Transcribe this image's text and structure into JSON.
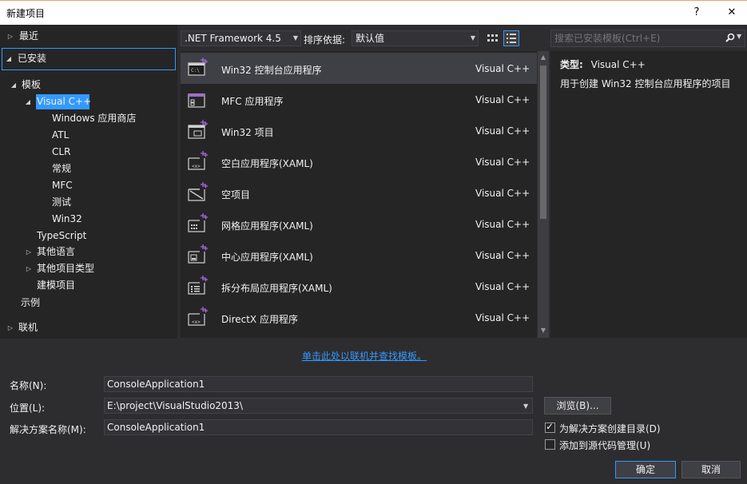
{
  "window": {
    "title": "新建项目",
    "help": "?",
    "close": "✕"
  },
  "tree": {
    "recent": "最近",
    "installed": "已安装",
    "templates": "模板",
    "visual_cpp": "Visual C++",
    "vc_children": [
      "Windows 应用商店",
      "ATL",
      "CLR",
      "常规",
      "MFC",
      "测试",
      "Win32"
    ],
    "typescript": "TypeScript",
    "other_languages": "其他语言",
    "other_project_types": "其他项目类型",
    "modeling_projects": "建模项目",
    "samples": "示例",
    "online": "联机"
  },
  "toolbar": {
    "framework": ".NET Framework 4.5",
    "sort_label": "排序依据:",
    "sort_value": "默认值"
  },
  "templates": [
    {
      "name": "Win32 控制台应用程序",
      "lang": "Visual C++",
      "icon": "console-app-icon"
    },
    {
      "name": "MFC 应用程序",
      "lang": "Visual C++",
      "icon": "mfc-app-icon"
    },
    {
      "name": "Win32 项目",
      "lang": "Visual C++",
      "icon": "win32-project-icon"
    },
    {
      "name": "空白应用程序(XAML)",
      "lang": "Visual C++",
      "icon": "blank-xaml-app-icon"
    },
    {
      "name": "空项目",
      "lang": "Visual C++",
      "icon": "empty-project-icon"
    },
    {
      "name": "网格应用程序(XAML)",
      "lang": "Visual C++",
      "icon": "grid-xaml-app-icon"
    },
    {
      "name": "中心应用程序(XAML)",
      "lang": "Visual C++",
      "icon": "hub-xaml-app-icon"
    },
    {
      "name": "拆分布局应用程序(XAML)",
      "lang": "Visual C++",
      "icon": "split-xaml-app-icon"
    },
    {
      "name": "DirectX 应用程序",
      "lang": "Visual C++",
      "icon": "directx-app-icon"
    }
  ],
  "online_link": "单击此处以联机并查找模板。",
  "search": {
    "placeholder": "搜索已安装模板(Ctrl+E)"
  },
  "detail": {
    "type_label": "类型:",
    "type_value": "Visual C++",
    "description": "用于创建 Win32 控制台应用程序的项目"
  },
  "form": {
    "name_label": "名称(N):",
    "name_value": "ConsoleApplication1",
    "location_label": "位置(L):",
    "location_value": "E:\\project\\VisualStudio2013\\",
    "solution_label": "解决方案名称(M):",
    "solution_value": "ConsoleApplication1",
    "browse": "浏览(B)...",
    "create_dir": "为解决方案创建目录(D)",
    "create_dir_checked": true,
    "add_scc": "添加到源代码管理(U)",
    "add_scc_checked": false,
    "ok": "确定",
    "cancel": "取消"
  },
  "colors": {
    "accent": "#3399ff",
    "background": "#2d2d30",
    "panel": "#252526",
    "icon_accent": "#a566d8"
  }
}
